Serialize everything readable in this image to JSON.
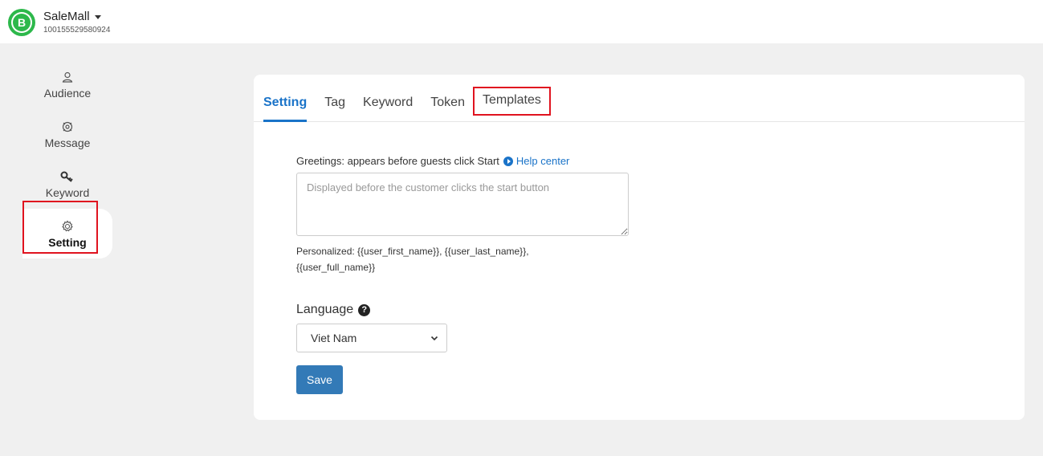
{
  "header": {
    "logo_letter": "B",
    "page_name": "SaleMall",
    "page_id": "100155529580924",
    "brand_color": "#2db84b"
  },
  "sidebar": {
    "items": [
      {
        "label": "Audience",
        "icon": "user-icon"
      },
      {
        "label": "Message",
        "icon": "message-icon"
      },
      {
        "label": "Keyword",
        "icon": "key-icon"
      },
      {
        "label": "Setting",
        "icon": "gear-icon",
        "active": true
      }
    ],
    "highlight_color": "#e0131f"
  },
  "tabs": {
    "items": [
      "Setting",
      "Tag",
      "Keyword",
      "Token",
      "Templates"
    ],
    "active": "Setting",
    "accent_color": "#1a73c8"
  },
  "form": {
    "greeting_label": "Greetings: appears before guests click Start",
    "help_link": "Help center",
    "greeting_value": "",
    "greeting_placeholder": "Displayed before the customer clicks the start button",
    "personalized_text": "Personalized: {{user_first_name}}, {{user_last_name}}, {{user_full_name}}",
    "language_label": "Language",
    "language_help_icon": "?",
    "language_selected": "Viet Nam",
    "save_label": "Save",
    "button_color": "#337ab7"
  }
}
